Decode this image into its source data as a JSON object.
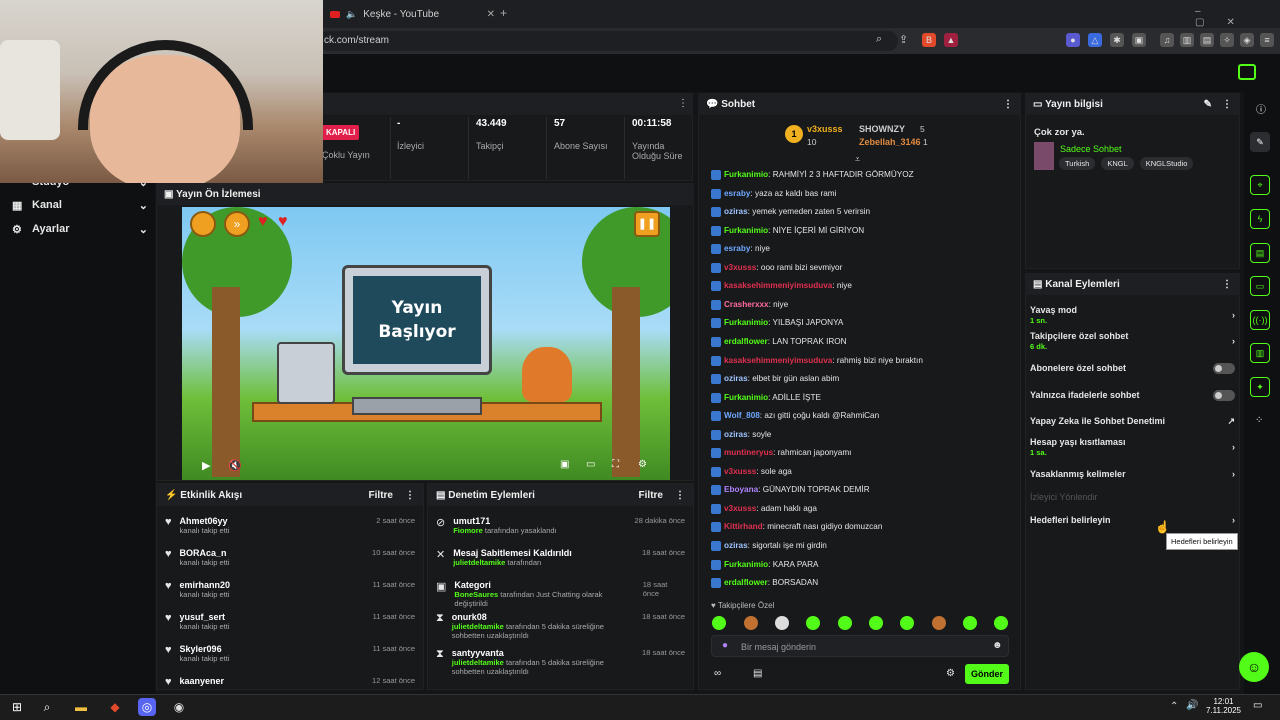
{
  "browser": {
    "tab_title": "Keşke - YouTube",
    "url": "ck.com/stream"
  },
  "sidebar": {
    "items": [
      {
        "label": "Stüdyo"
      },
      {
        "label": "Kanal"
      },
      {
        "label": "Ayarlar"
      }
    ]
  },
  "stats": {
    "status_badge": "KAPALI",
    "status_label": "Çoklu Yayın",
    "viewers_value": "-",
    "viewers_label": "İzleyici",
    "followers_value": "43.449",
    "followers_label": "Takipçi",
    "subs_value": "57",
    "subs_label": "Abone Sayısı",
    "uptime_value": "00:11:58",
    "uptime_label": "Yayında Olduğu Süre"
  },
  "preview": {
    "title": "Yayın Ön İzlemesi",
    "screen_text": "Yayın Başlıyor"
  },
  "activity": {
    "title": "Etkinlik Akışı",
    "filter": "Filtre",
    "rows": [
      {
        "name": "Ahmet06yy",
        "desc": "kanalı takip etti",
        "time": "2 saat önce"
      },
      {
        "name": "BORAca_n",
        "desc": "kanalı takip etti",
        "time": "10 saat önce"
      },
      {
        "name": "emirhann20",
        "desc": "kanalı takip etti",
        "time": "11 saat önce"
      },
      {
        "name": "yusuf_sert",
        "desc": "kanalı takip etti",
        "time": "11 saat önce"
      },
      {
        "name": "Skyler096",
        "desc": "kanalı takip etti",
        "time": "11 saat önce"
      },
      {
        "name": "kaanyener",
        "desc": "",
        "time": "12 saat önce"
      }
    ]
  },
  "moderation": {
    "title": "Denetim Eylemleri",
    "filter": "Filtre",
    "rows": [
      {
        "name": "umut171",
        "actor": "Fiomore",
        "desc": "tarafından yasaklandı",
        "time": "28 dakika önce"
      },
      {
        "name": "Mesaj Sabitlemesi Kaldırıldı",
        "actor": "julietdeltamike",
        "desc": "tarafından",
        "time": "18 saat önce"
      },
      {
        "name": "Kategori",
        "actor": "BoneSaures",
        "desc": "tarafından Just Chatting olarak değiştirildi",
        "time": "18 saat önce"
      },
      {
        "name": "onurk08",
        "actor": "julietdeltamike",
        "desc": "tarafından 5 dakika süreliğine sohbetten uzaklaştırıldı",
        "time": "18 saat önce"
      },
      {
        "name": "santyyvanta",
        "actor": "julietdeltamike",
        "desc": "tarafından 5 dakika süreliğine sohbetten uzaklaştırıldı",
        "time": "18 saat önce"
      }
    ]
  },
  "chat": {
    "title": "Sohbet",
    "leader1_name": "v3xusss",
    "leader1_count": "10",
    "leader2_name": "SHOWNZY",
    "leader2_count": "5",
    "leader3_name": "Zebellah_3146",
    "leader3_count": "1",
    "messages": [
      {
        "user": "Furkanimio",
        "color": "#53fc18",
        "text": "RAHMİYİ 2 3 HAFTADIR GÖRMÜYOZ"
      },
      {
        "user": "esraby",
        "color": "#6fa8ff",
        "text": "yaza az kaldı bas rami"
      },
      {
        "user": "oziras",
        "color": "#a0c4ff",
        "text": "yemek yemeden zaten 5 verirsin"
      },
      {
        "user": "Furkanimio",
        "color": "#53fc18",
        "text": "NİYE İÇERİ Mİ GİRİYON"
      },
      {
        "user": "esraby",
        "color": "#6fa8ff",
        "text": "niye"
      },
      {
        "user": "v3xusss",
        "color": "#e03050",
        "text": "ooo rami bizi sevmiyor"
      },
      {
        "user": "kasaksehimmeniyimsuduva",
        "color": "#e03050",
        "text": "niye"
      },
      {
        "user": "Crasherxxx",
        "color": "#ff6b9a",
        "text": "niye"
      },
      {
        "user": "Furkanimio",
        "color": "#53fc18",
        "text": "YILBAŞI JAPONYA"
      },
      {
        "user": "erdalflower",
        "color": "#53fc18",
        "text": "LAN TOPRAK IRON"
      },
      {
        "user": "kasaksehimmeniyimsuduva",
        "color": "#e03050",
        "text": "rahmiş bizi niye bıraktın"
      },
      {
        "user": "oziras",
        "color": "#a0c4ff",
        "text": "elbet bir gün aslan abim"
      },
      {
        "user": "Furkanimio",
        "color": "#53fc18",
        "text": "ADİLLE İŞTE"
      },
      {
        "user": "Wolf_808",
        "color": "#6fa8ff",
        "text": "azı gitti çoğu kaldı @RahmiCan"
      },
      {
        "user": "oziras",
        "color": "#a0c4ff",
        "text": "soyle"
      },
      {
        "user": "muntineryus",
        "color": "#e03050",
        "text": "rahmican japonyamı"
      },
      {
        "user": "v3xusss",
        "color": "#e03050",
        "text": "sole aga"
      },
      {
        "user": "Eboyana",
        "color": "#b084ff",
        "text": "GÜNAYDIN TOPRAK DEMİR"
      },
      {
        "user": "v3xusss",
        "color": "#e03050",
        "text": "adam haklı aga"
      },
      {
        "user": "Kittirhand",
        "color": "#e03050",
        "text": "minecraft nası gidiyo domuzcan"
      },
      {
        "user": "oziras",
        "color": "#a0c4ff",
        "text": "sigortalı işe mi girdin"
      },
      {
        "user": "Furkanimio",
        "color": "#53fc18",
        "text": "KARA PARA"
      },
      {
        "user": "erdalflower",
        "color": "#53fc18",
        "text": "BORSADAN"
      }
    ],
    "followers_only": "Takipçilere Özel",
    "input_placeholder": "Bir mesaj gönderin",
    "send": "Gönder"
  },
  "stream_info": {
    "title": "Yayın bilgisi",
    "stream_title": "Çok zor ya.",
    "category": "Sadece Sohbet",
    "tags": [
      "Turkish",
      "KNGL",
      "KNGLStudio"
    ]
  },
  "channel_actions": {
    "title": "Kanal Eylemleri",
    "items": [
      {
        "label": "Yavaş mod",
        "sub": "1 sn."
      },
      {
        "label": "Takipçilere özel sohbet",
        "sub": "6 dk."
      },
      {
        "label": "Abonelere özel sohbet",
        "sub": ""
      },
      {
        "label": "Yalnızca ifadelerle sohbet",
        "sub": ""
      },
      {
        "label": "Yapay Zeka ile Sohbet Denetimi",
        "sub": ""
      },
      {
        "label": "Hesap yaşı kısıtlaması",
        "sub": "1 sa."
      },
      {
        "label": "Yasaklanmış kelimeler",
        "sub": ""
      },
      {
        "label": "İzleyici Yönlendir",
        "sub": ""
      },
      {
        "label": "Hedefleri belirleyin",
        "sub": ""
      }
    ],
    "tooltip": "Hedefleri belirleyin"
  },
  "taskbar": {
    "time": "12:01",
    "date": "7.11.2025"
  },
  "colors": {
    "accent": "#53fc18",
    "badge": "#e0204a"
  }
}
